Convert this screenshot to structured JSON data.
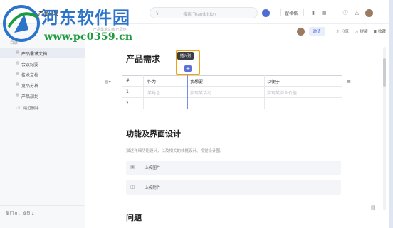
{
  "watermark": {
    "line1": "河东软件园",
    "line2": "www.pc0359.cn"
  },
  "topbar": {
    "project_title": "产品研发",
    "search_placeholder": "搜索 Teambition",
    "user_name": "翟格格",
    "add_icon": "plus-icon",
    "icons": [
      "bookmark-icon",
      "calendar-icon",
      "help-icon",
      "bell-icon"
    ]
  },
  "doc_header": {
    "breadcrumb": "产品需求文档  已同步",
    "invite_label": "邀请",
    "share_label": "分享",
    "remind_label": "提醒",
    "favorite_label": "收藏"
  },
  "sidebar": {
    "group_label": "目录",
    "items": [
      {
        "label": "产品需求文档",
        "active": true
      },
      {
        "label": "会议纪要",
        "active": false
      },
      {
        "label": "技术文档",
        "active": false
      },
      {
        "label": "竞品分析",
        "active": false
      },
      {
        "label": "产品规划",
        "active": false
      }
    ],
    "trash_label": "最近删除",
    "footer": "部门 0 、成员 1"
  },
  "document": {
    "heading1": "产品需求",
    "tooltip": "插入列",
    "table": {
      "headers": [
        "#",
        "作为",
        "我想要",
        "以便于"
      ],
      "rows": [
        {
          "num": "1",
          "as": "某角色",
          "want": "实现某活动",
          "so_that": "实现某商业价值"
        },
        {
          "num": "2",
          "as": "",
          "want": "",
          "so_that": ""
        }
      ]
    },
    "heading2": "功能及界面设计",
    "description": "描述详细功能设计，以及相关的线框设计、视觉设计图。",
    "upload_image_label": "+ 上传图片",
    "upload_file_label": "+ 上传附件",
    "heading3": "问题"
  },
  "colors": {
    "accent": "#4f6bd6",
    "highlight": "#f0a30a",
    "watermark_blue": "#2b74c9",
    "watermark_green": "#1c9b3d"
  }
}
